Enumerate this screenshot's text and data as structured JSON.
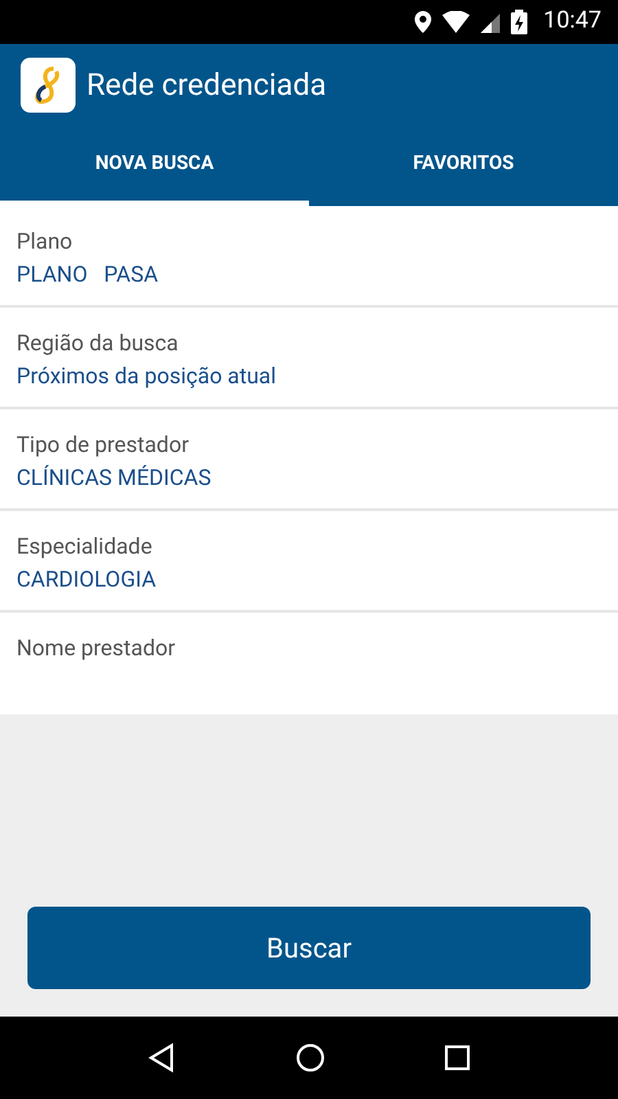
{
  "status_bar": {
    "time": "10:47"
  },
  "app_bar": {
    "title": "Rede credenciada"
  },
  "tabs": [
    {
      "label": "NOVA BUSCA",
      "selected": true
    },
    {
      "label": "FAVORITOS",
      "selected": false
    }
  ],
  "fields": [
    {
      "kind": "select",
      "label": "Plano",
      "value": "PLANO   PASA"
    },
    {
      "kind": "select",
      "label": "Região da busca",
      "value": "Próximos da posição atual"
    },
    {
      "kind": "select",
      "label": "Tipo de prestador",
      "value": "CLÍNICAS MÉDICAS"
    },
    {
      "kind": "select",
      "label": "Especialidade",
      "value": "CARDIOLOGIA"
    },
    {
      "kind": "input",
      "label": "Nome prestador"
    }
  ],
  "search_button": {
    "label": "Buscar"
  }
}
